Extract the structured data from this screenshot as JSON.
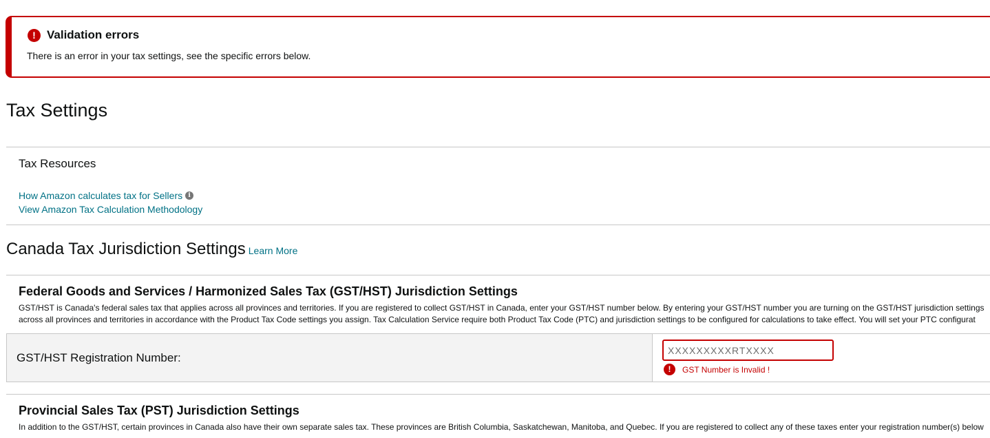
{
  "alert": {
    "title": "Validation errors",
    "message": "There is an error in your tax settings, see the specific errors below.",
    "icon": "!"
  },
  "page": {
    "title": "Tax Settings"
  },
  "resources": {
    "title": "Tax Resources",
    "links": [
      {
        "label": "How Amazon calculates tax for Sellers",
        "info_icon": "i"
      },
      {
        "label": "View Amazon Tax Calculation Methodology"
      }
    ]
  },
  "jurisdiction": {
    "title": "Canada Tax Jurisdiction Settings",
    "learn_more": "Learn More"
  },
  "gst": {
    "title": "Federal Goods and Services / Harmonized Sales Tax (GST/HST) Jurisdiction Settings",
    "desc_line1": "GST/HST is Canada's federal sales tax that applies across all provinces and territories. If you are registered to collect GST/HST in Canada, enter your GST/HST number below. By entering your GST/HST number you are turning on the GST/HST jurisdiction settings",
    "desc_line2": "across all provinces and territories in accordance with the Product Tax Code settings you assign. Tax Calculation Service require both Product Tax Code (PTC) and jurisdiction settings to be configured for calculations to take effect. You will set your PTC configurat",
    "reg_label": "GST/HST Registration Number:",
    "reg_placeholder": "XXXXXXXXXRTXXXX",
    "reg_value": "",
    "error_icon": "!",
    "error_text": "GST Number is Invalid !"
  },
  "pst": {
    "title": "Provincial Sales Tax (PST) Jurisdiction Settings",
    "desc_line1": "In addition to the GST/HST, certain provinces in Canada also have their own separate sales tax. These provinces are British Columbia, Saskatchewan, Manitoba, and Quebec. If you are registered to collect any of these taxes enter your registration number(s) below"
  },
  "colors": {
    "error": "#c40000",
    "link": "#007185",
    "row_bg": "#f3f3f3"
  }
}
